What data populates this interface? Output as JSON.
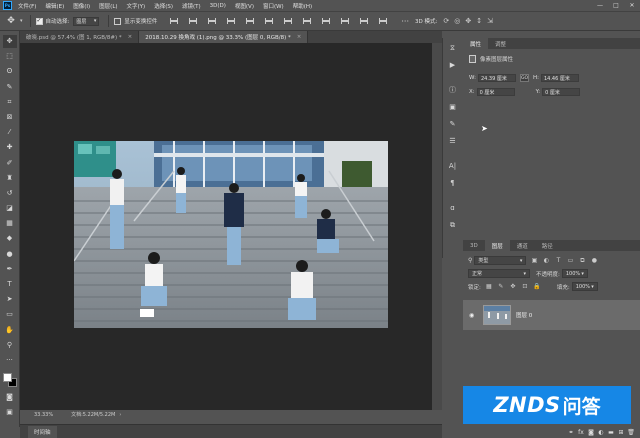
{
  "menu": {
    "items": [
      "文件(F)",
      "编辑(E)",
      "图像(I)",
      "图层(L)",
      "文字(Y)",
      "选择(S)",
      "滤镜(T)",
      "3D(D)",
      "视图(V)",
      "窗口(W)",
      "帮助(H)"
    ],
    "window_controls": [
      "—",
      "□",
      "✕"
    ]
  },
  "options_bar": {
    "auto_select_label": "自动选择:",
    "auto_select_value": "图层",
    "show_transform_label": "显示变换控件",
    "mode_3d": "3D 模式:"
  },
  "doc_tabs": [
    {
      "label": "破晓.psd @ 57.4% (图 1, RGB/8#) *",
      "active": false
    },
    {
      "label": "2018.10.29 換角戏 (1).png @ 33.3% (图层 0, RGB/8) *",
      "active": true
    }
  ],
  "status_bar": {
    "zoom": "33.33%",
    "doc_size": "文档:5.22M/5.22M"
  },
  "timeline": {
    "label": "时间轴"
  },
  "properties_panel": {
    "tabs": [
      {
        "label": "属性",
        "active": true
      },
      {
        "label": "调整",
        "active": false
      }
    ],
    "section_title": "像素图层属性",
    "w_label": "W:",
    "w_value": "24.39 厘米",
    "link_label": "GO",
    "h_label": "H:",
    "h_value": "14.46 厘米",
    "x_label": "X:",
    "x_value": "0 厘米",
    "y_label": "Y:",
    "y_value": "0 厘米"
  },
  "layers_panel": {
    "tabs": [
      {
        "label": "3D",
        "active": false
      },
      {
        "label": "图层",
        "active": true
      },
      {
        "label": "通道",
        "active": false
      },
      {
        "label": "路径",
        "active": false
      }
    ],
    "filter_value": "类型",
    "blend_mode": "正常",
    "opacity_label": "不透明度:",
    "opacity_value": "100%",
    "lock_label": "锁定:",
    "fill_label": "填充:",
    "fill_value": "100%",
    "layers": [
      {
        "name": "图层 0",
        "visible": true
      }
    ]
  },
  "watermark": {
    "brand": "ZNDS",
    "sub": "问答"
  },
  "colors": {
    "accent": "#31a8ff",
    "watermark_bg": "#1687e6",
    "panel_bg": "#535353",
    "canvas_bg": "#282828"
  }
}
